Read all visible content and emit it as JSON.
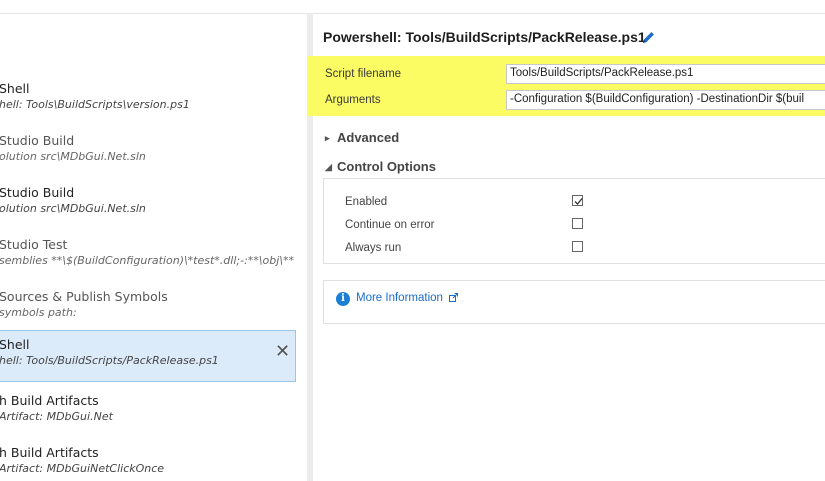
{
  "tasks": [
    {
      "title": "Shell",
      "subtitle": "hell: Tools\\BuildScripts\\version.ps1",
      "selected": false
    },
    {
      "title": "Studio Build",
      "subtitle": "olution src\\MDbGui.Net.sln",
      "selected": false
    },
    {
      "title": "Studio Build",
      "subtitle": "olution src\\MDbGui.Net.sln",
      "selected": false
    },
    {
      "title": "Studio Test",
      "subtitle": "semblies **\\$(BuildConfiguration)\\*test*.dll;-:**\\obj\\**",
      "selected": false
    },
    {
      "title": "Sources & Publish Symbols",
      "subtitle": "symbols path:",
      "selected": false
    },
    {
      "title": "Shell",
      "subtitle": "hell: Tools/BuildScripts/PackRelease.ps1",
      "selected": true
    },
    {
      "title": "h Build Artifacts",
      "subtitle": "Artifact: MDbGui.Net",
      "selected": false
    },
    {
      "title": "h Build Artifacts",
      "subtitle": "Artifact: MDbGuiNetClickOnce",
      "selected": false
    }
  ],
  "task_remove_glyph": "✕",
  "detail": {
    "title": "Powershell: Tools/BuildScripts/PackRelease.ps1",
    "edit_icon": "pencil-icon",
    "fields": {
      "script_label": "Script filename",
      "script_value": "Tools/BuildScripts/PackRelease.ps1",
      "args_label": "Arguments",
      "args_value": "-Configuration $(BuildConfiguration) -DestinationDir $(buil"
    },
    "advanced_label": "Advanced",
    "control_options_label": "Control Options",
    "options": [
      {
        "label": "Enabled",
        "checked": true
      },
      {
        "label": "Continue on error",
        "checked": false
      },
      {
        "label": "Always run",
        "checked": false
      }
    ],
    "more_info_label": "More Information",
    "info_glyph": "i"
  },
  "colors": {
    "highlight": "#fbfb63",
    "selected_bg": "#dcebfa",
    "link": "#1a6fc9",
    "info_icon": "#1c7fd6"
  }
}
